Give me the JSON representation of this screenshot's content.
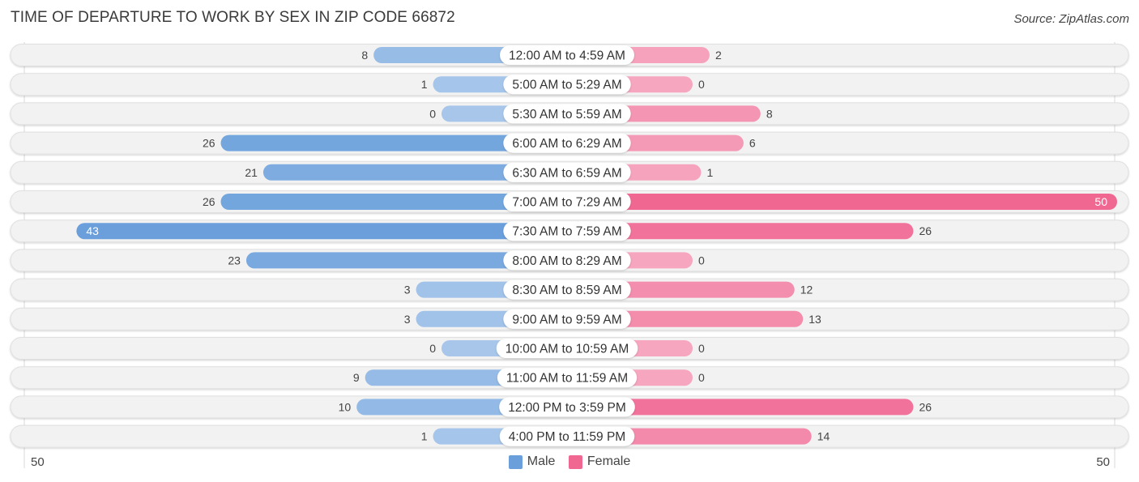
{
  "header": {
    "title": "TIME OF DEPARTURE TO WORK BY SEX IN ZIP CODE 66872",
    "source": "Source: ZipAtlas.com"
  },
  "colors": {
    "male": "#6a9fdc",
    "male_light": "#a7c6ea",
    "female": "#f06892",
    "female_light": "#f6a6bf",
    "row_bg": "#f2f2f2"
  },
  "chart_data": {
    "type": "bar",
    "orientation": "horizontal-diverging",
    "title": "TIME OF DEPARTURE TO WORK BY SEX IN ZIP CODE 66872",
    "categories": [
      "12:00 AM to 4:59 AM",
      "5:00 AM to 5:29 AM",
      "5:30 AM to 5:59 AM",
      "6:00 AM to 6:29 AM",
      "6:30 AM to 6:59 AM",
      "7:00 AM to 7:29 AM",
      "7:30 AM to 7:59 AM",
      "8:00 AM to 8:29 AM",
      "8:30 AM to 8:59 AM",
      "9:00 AM to 9:59 AM",
      "10:00 AM to 10:59 AM",
      "11:00 AM to 11:59 AM",
      "12:00 PM to 3:59 PM",
      "4:00 PM to 11:59 PM"
    ],
    "series": [
      {
        "name": "Male",
        "values": [
          8,
          1,
          0,
          26,
          21,
          26,
          43,
          23,
          3,
          3,
          0,
          9,
          10,
          1
        ]
      },
      {
        "name": "Female",
        "values": [
          2,
          0,
          8,
          6,
          1,
          50,
          26,
          0,
          12,
          13,
          0,
          0,
          26,
          14
        ]
      }
    ],
    "axis": {
      "left_label": "50",
      "right_label": "50",
      "max": 50
    },
    "legend": {
      "position": "bottom-center",
      "entries": [
        "Male",
        "Female"
      ]
    }
  }
}
